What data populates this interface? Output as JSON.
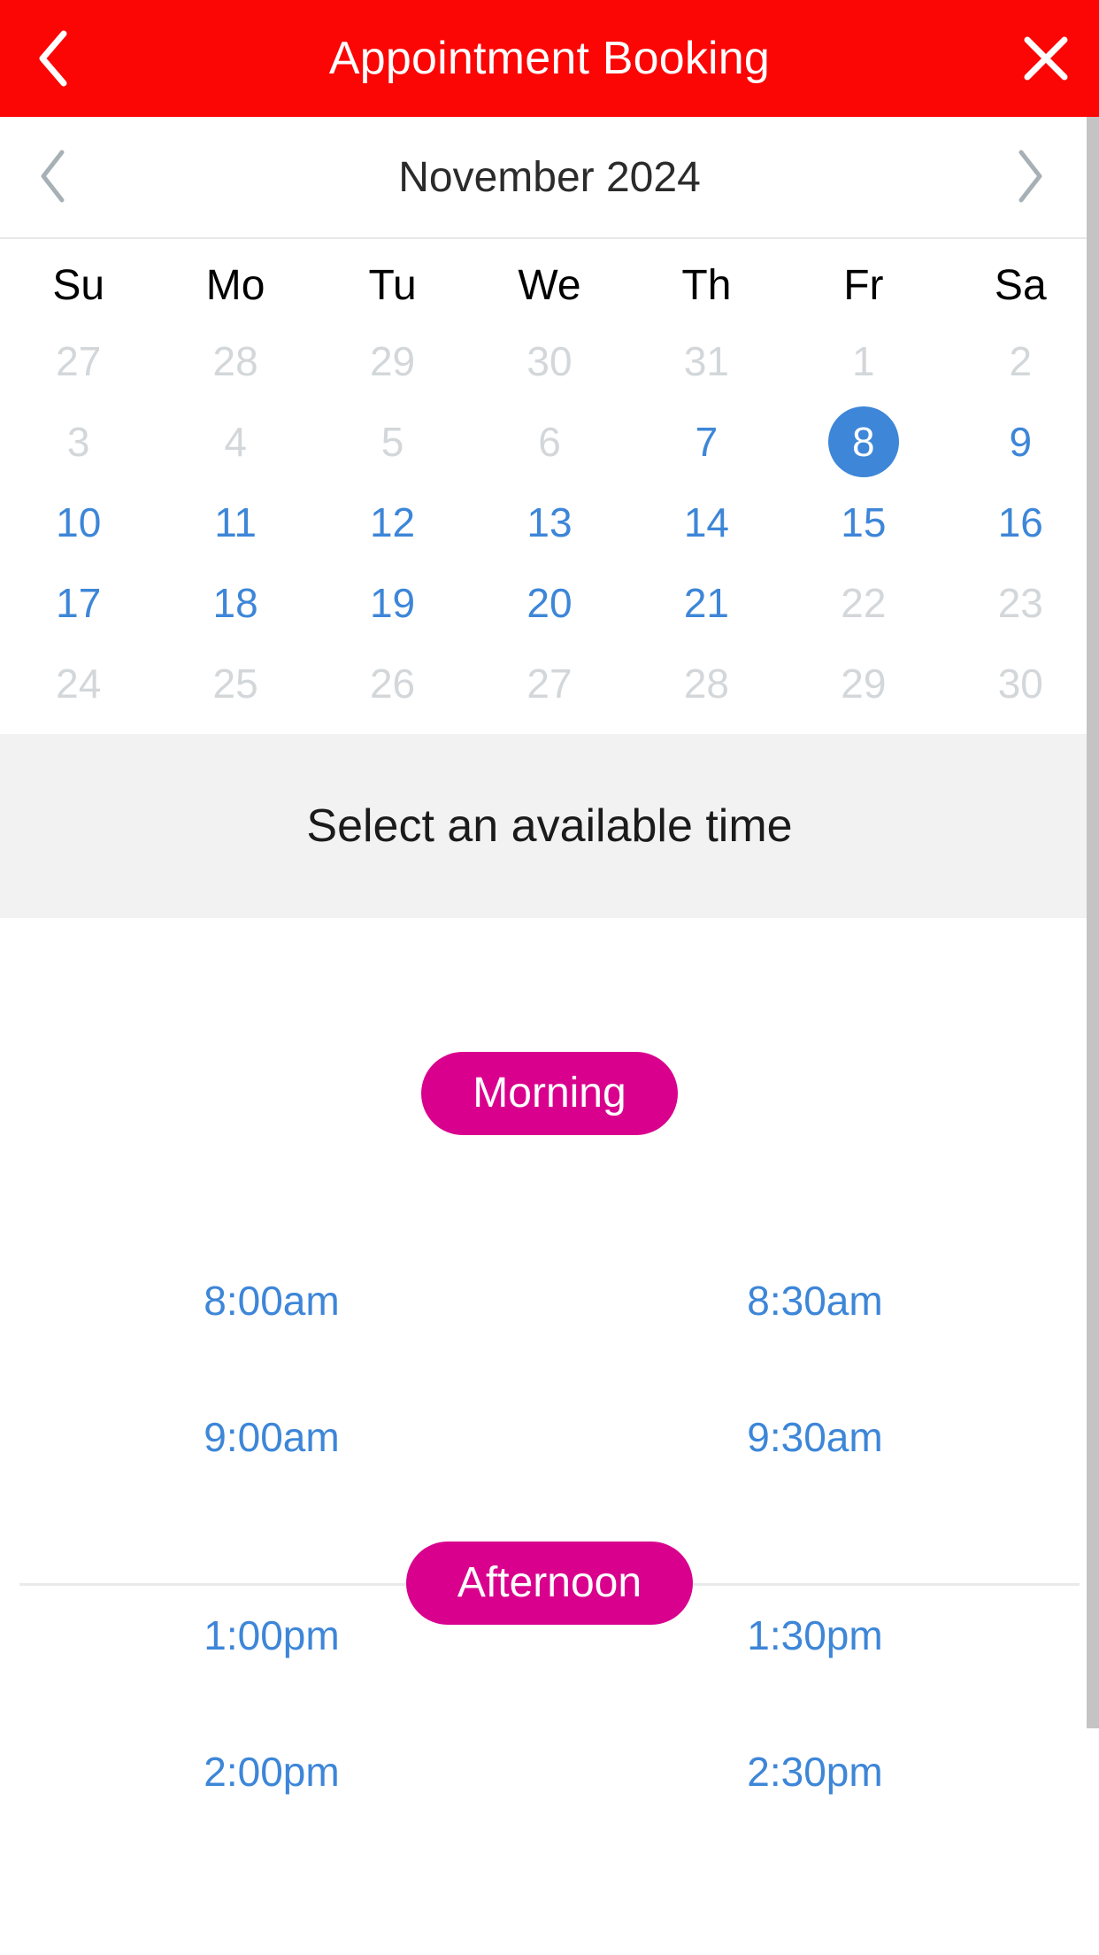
{
  "header": {
    "title": "Appointment Booking",
    "back_icon": "chevron-left-icon",
    "close_icon": "close-icon",
    "background": "#fb0505",
    "text_color": "#ffffff"
  },
  "calendar": {
    "month_label": "November 2024",
    "prev_icon": "chevron-left-icon",
    "next_icon": "chevron-right-icon",
    "weekdays": [
      "Su",
      "Mo",
      "Tu",
      "We",
      "Th",
      "Fr",
      "Sa"
    ],
    "selected_day": "8",
    "accent_color": "#3d86d8",
    "disabled_color": "#d3d7da",
    "weeks": [
      [
        {
          "label": "27",
          "state": "disabled"
        },
        {
          "label": "28",
          "state": "disabled"
        },
        {
          "label": "29",
          "state": "disabled"
        },
        {
          "label": "30",
          "state": "disabled"
        },
        {
          "label": "31",
          "state": "disabled"
        },
        {
          "label": "1",
          "state": "disabled"
        },
        {
          "label": "2",
          "state": "disabled"
        }
      ],
      [
        {
          "label": "3",
          "state": "disabled"
        },
        {
          "label": "4",
          "state": "disabled"
        },
        {
          "label": "5",
          "state": "disabled"
        },
        {
          "label": "6",
          "state": "disabled"
        },
        {
          "label": "7",
          "state": "enabled"
        },
        {
          "label": "8",
          "state": "selected"
        },
        {
          "label": "9",
          "state": "enabled"
        }
      ],
      [
        {
          "label": "10",
          "state": "enabled"
        },
        {
          "label": "11",
          "state": "enabled"
        },
        {
          "label": "12",
          "state": "enabled"
        },
        {
          "label": "13",
          "state": "enabled"
        },
        {
          "label": "14",
          "state": "enabled"
        },
        {
          "label": "15",
          "state": "enabled"
        },
        {
          "label": "16",
          "state": "enabled"
        }
      ],
      [
        {
          "label": "17",
          "state": "enabled"
        },
        {
          "label": "18",
          "state": "enabled"
        },
        {
          "label": "19",
          "state": "enabled"
        },
        {
          "label": "20",
          "state": "enabled"
        },
        {
          "label": "21",
          "state": "enabled"
        },
        {
          "label": "22",
          "state": "disabled"
        },
        {
          "label": "23",
          "state": "disabled"
        }
      ],
      [
        {
          "label": "24",
          "state": "disabled"
        },
        {
          "label": "25",
          "state": "disabled"
        },
        {
          "label": "26",
          "state": "disabled"
        },
        {
          "label": "27",
          "state": "disabled"
        },
        {
          "label": "28",
          "state": "disabled"
        },
        {
          "label": "29",
          "state": "disabled"
        },
        {
          "label": "30",
          "state": "disabled"
        }
      ]
    ]
  },
  "time_section": {
    "title": "Select an available time",
    "band_background": "#f2f2f2",
    "pill_color": "#d9008e",
    "slot_color": "#3d86d8",
    "groups": [
      {
        "label": "Morning",
        "slots": [
          "8:00am",
          "8:30am",
          "9:00am",
          "9:30am"
        ]
      },
      {
        "label": "Afternoon",
        "slots": [
          "1:00pm",
          "1:30pm",
          "2:00pm",
          "2:30pm"
        ]
      }
    ]
  },
  "scrollbar": {
    "thumb_color": "#c4c4c4"
  }
}
